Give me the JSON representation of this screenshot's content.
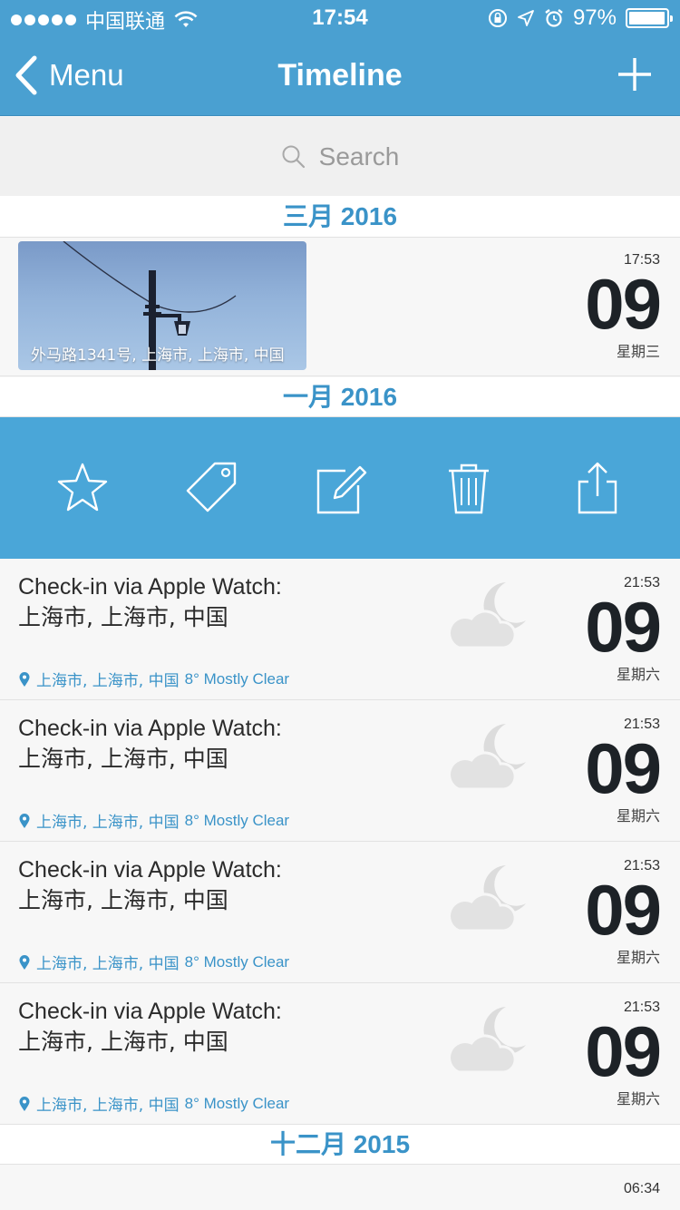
{
  "status_bar": {
    "carrier": "中国联通",
    "time": "17:54",
    "battery": "97%",
    "battery_level": 0.97
  },
  "nav": {
    "back_label": "Menu",
    "title": "Timeline",
    "add_icon": "plus-icon"
  },
  "search": {
    "placeholder": "Search"
  },
  "sections": [
    {
      "label": "三月 2016"
    },
    {
      "label": "一月 2016"
    },
    {
      "label": "十二月 2015"
    }
  ],
  "photo_entry": {
    "caption": "外马路1341号, 上海市, 上海市, 中国",
    "time": "17:53",
    "day": "09",
    "weekday": "星期三"
  },
  "actions": [
    {
      "name": "star-icon"
    },
    {
      "name": "tag-icon"
    },
    {
      "name": "edit-icon"
    },
    {
      "name": "trash-icon"
    },
    {
      "name": "share-icon"
    }
  ],
  "entries": [
    {
      "title_line1": "Check-in via Apple Watch:",
      "title_line2": "上海市, 上海市, 中国",
      "location": "上海市, 上海市, 中国",
      "weather": "8° Mostly Clear",
      "time": "21:53",
      "day": "09",
      "weekday": "星期六"
    },
    {
      "title_line1": "Check-in via Apple Watch:",
      "title_line2": "上海市, 上海市, 中国",
      "location": "上海市, 上海市, 中国",
      "weather": "8° Mostly Clear",
      "time": "21:53",
      "day": "09",
      "weekday": "星期六"
    },
    {
      "title_line1": "Check-in via Apple Watch:",
      "title_line2": "上海市, 上海市, 中国",
      "location": "上海市, 上海市, 中国",
      "weather": "8° Mostly Clear",
      "time": "21:53",
      "day": "09",
      "weekday": "星期六"
    },
    {
      "title_line1": "Check-in via Apple Watch:",
      "title_line2": "上海市, 上海市, 中国",
      "location": "上海市, 上海市, 中国",
      "weather": "8° Mostly Clear",
      "time": "21:53",
      "day": "09",
      "weekday": "星期六"
    }
  ],
  "last_entry": {
    "time": "06:34"
  },
  "colors": {
    "accent": "#4aa0d1",
    "section_text": "#3a93c8"
  }
}
